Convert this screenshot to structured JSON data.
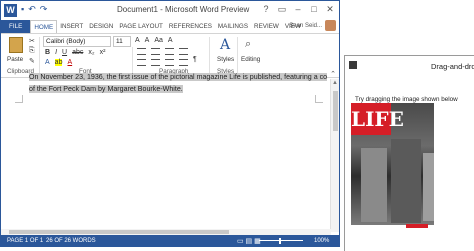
{
  "word": {
    "title": "Document1 - Microsoft Word Preview",
    "app_icon": "W",
    "qat": [
      "save-icon",
      "undo-icon",
      "redo-icon"
    ],
    "window_buttons": [
      "?",
      "▭",
      "–",
      "□",
      "✕"
    ],
    "tabs": [
      "FILE",
      "HOME",
      "INSERT",
      "DESIGN",
      "PAGE LAYOUT",
      "REFERENCES",
      "MAILINGS",
      "REVIEW",
      "VIEW"
    ],
    "active_tab": "HOME",
    "user": "Sean Seid...",
    "ribbon": {
      "paste_label": "Paste",
      "font_name": "Calibri (Body)",
      "font_size": "11",
      "groups": [
        "Clipboard",
        "Font",
        "Paragraph",
        "Styles"
      ],
      "styles_label": "Styles",
      "editing_label": "Editing",
      "format_row1": [
        "A",
        "A",
        "Aa",
        "A"
      ],
      "format_row2": [
        "B",
        "I",
        "U",
        "abc",
        "x₂",
        "x²"
      ],
      "format_row3": [
        "A",
        "ab",
        "A"
      ]
    },
    "document": {
      "line1": "On November 23, 1936, the first issue of the pictorial magazine Life is published, featuring a co",
      "line2": "of the Fort Peck Dam by Margaret Bourke-White."
    },
    "status": {
      "page": "PAGE 1 OF 1",
      "words": "26 OF 26 WORDS",
      "zoom": "100%"
    }
  },
  "dragdrop": {
    "title": "Drag-and-dro",
    "instruction": "Try dragging the image shown below",
    "logo_text": "LIFE"
  }
}
